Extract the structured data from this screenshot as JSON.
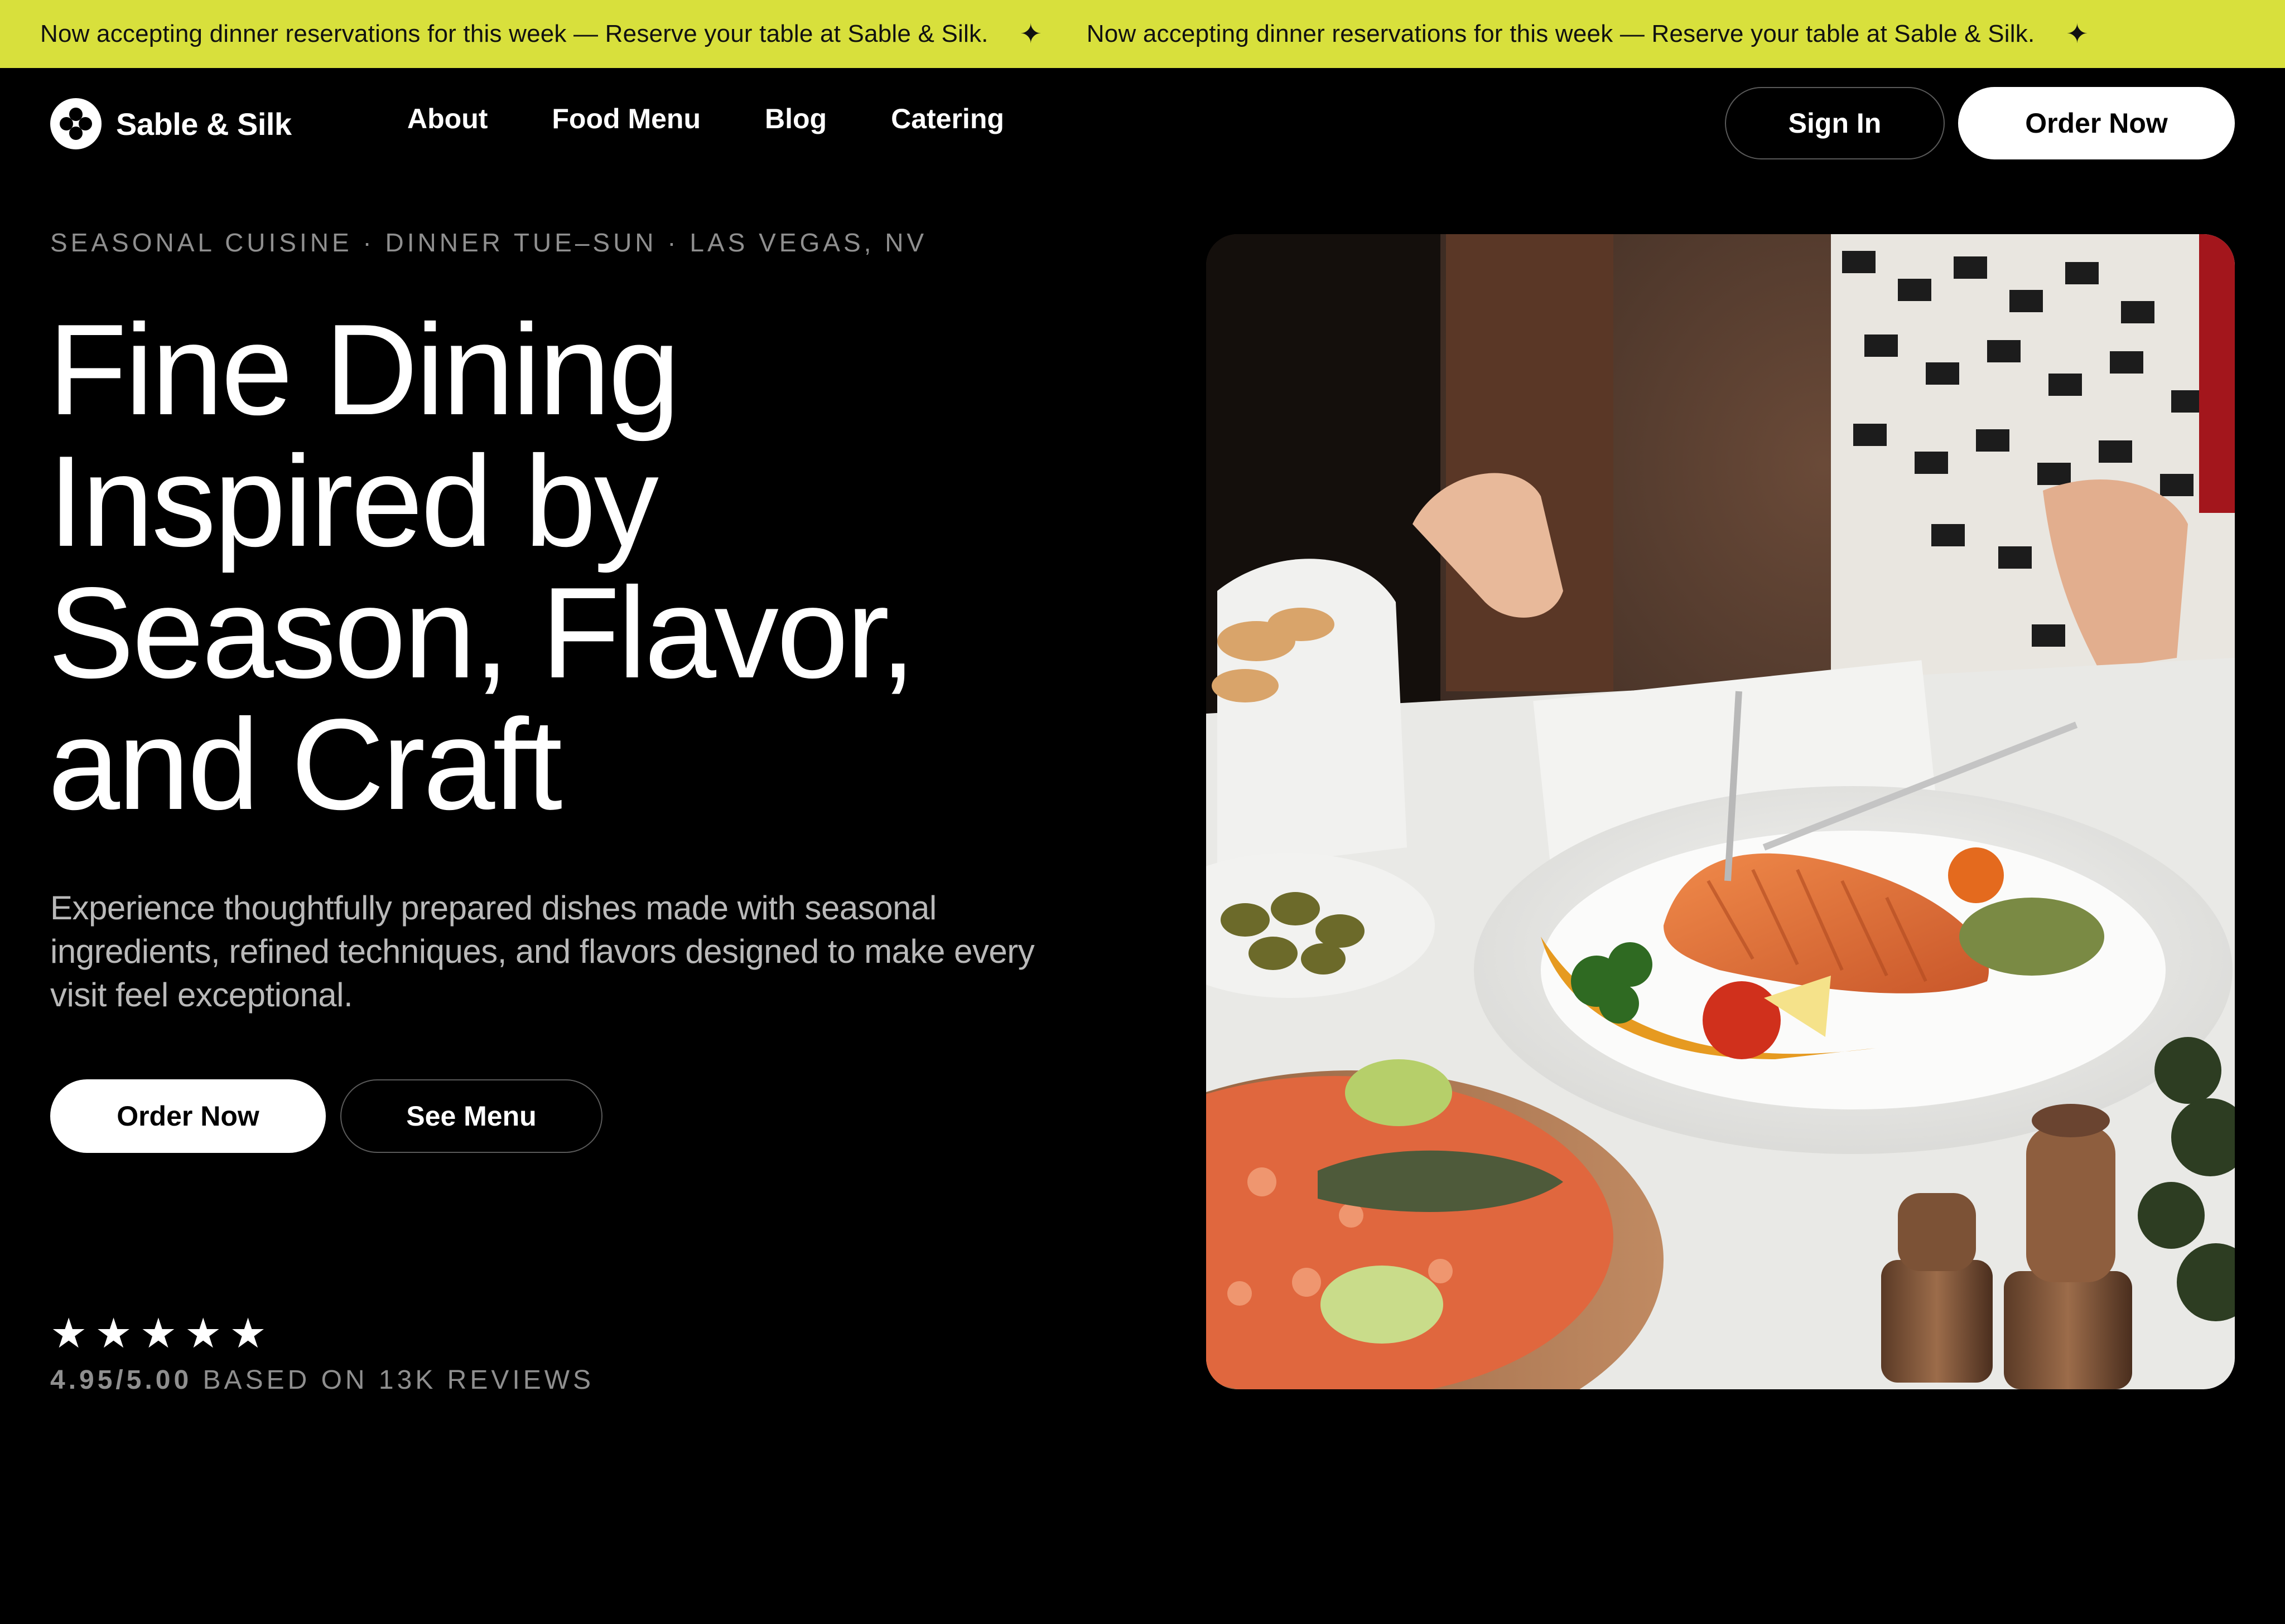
{
  "announcement": {
    "message": "Now accepting dinner reservations for this week — Reserve your table at Sable & Silk.",
    "separator": "✦"
  },
  "brand": {
    "name": "Sable & Silk"
  },
  "nav": {
    "links": [
      "About",
      "Food Menu",
      "Blog",
      "Catering"
    ],
    "sign_in_label": "Sign In",
    "order_label": "Order Now"
  },
  "hero": {
    "eyebrow": "SEASONAL CUISINE · DINNER TUE–SUN · LAS VEGAS, NV",
    "headline_lines": [
      "Fine Dining",
      "Inspired by",
      "Season, Flavor,",
      "and Craft"
    ],
    "subtext": "Experience thoughtfully prepared dishes made with seasonal ingredients, refined techniques, and flavors designed to make every visit feel exceptional.",
    "primary_cta": "Order Now",
    "secondary_cta": "See Menu",
    "rating": {
      "stars": 5,
      "star_glyph": "★",
      "score": "4.95/5.00",
      "caption": "BASED ON 13K REVIEWS"
    }
  },
  "colors": {
    "background": "#000000",
    "announcement_bg": "#d8e03c",
    "text_primary": "#ffffff",
    "text_muted": "#8f8f8f"
  }
}
